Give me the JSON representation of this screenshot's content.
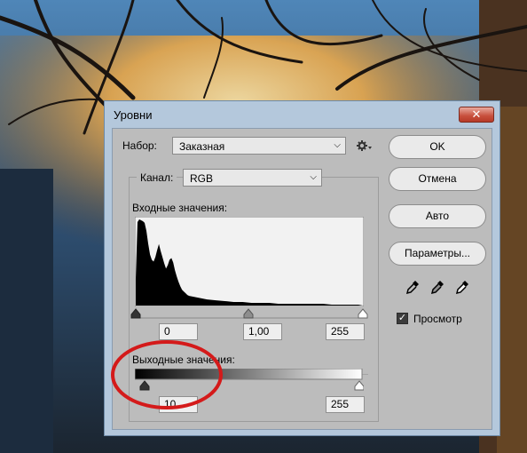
{
  "window": {
    "title": "Уровни",
    "close_glyph": "✕"
  },
  "preset": {
    "label": "Набор:",
    "value": "Заказная",
    "options_icon": "gear-icon"
  },
  "channel": {
    "label": "Канал:",
    "value": "RGB"
  },
  "input": {
    "label": "Входные значения:",
    "black": "0",
    "gamma": "1,00",
    "white": "255"
  },
  "output": {
    "label": "Выходные значения:",
    "black": "10",
    "white": "255"
  },
  "buttons": {
    "ok": "OK",
    "cancel": "Отмена",
    "auto": "Авто",
    "options": "Параметры..."
  },
  "eyedroppers": [
    "black-eyedropper-icon",
    "gray-eyedropper-icon",
    "white-eyedropper-icon"
  ],
  "preview": {
    "label": "Просмотр",
    "checked": true
  },
  "chart_data": {
    "type": "area",
    "xlim": [
      0,
      255
    ],
    "ylim": [
      0,
      100
    ],
    "x": [
      0,
      2,
      4,
      6,
      8,
      10,
      12,
      14,
      16,
      18,
      20,
      22,
      24,
      26,
      28,
      30,
      32,
      34,
      36,
      38,
      40,
      42,
      44,
      46,
      48,
      50,
      52,
      54,
      56,
      58,
      60,
      65,
      70,
      75,
      80,
      90,
      100,
      110,
      120,
      130,
      140,
      150,
      160,
      170,
      180,
      190,
      200,
      210,
      220,
      230,
      240,
      250,
      255
    ],
    "values": [
      30,
      95,
      98,
      97,
      96,
      94,
      85,
      70,
      58,
      52,
      50,
      55,
      63,
      70,
      62,
      55,
      48,
      42,
      46,
      52,
      54,
      49,
      40,
      33,
      27,
      22,
      18,
      16,
      14,
      12,
      11,
      10,
      9,
      8,
      7,
      6,
      5,
      4,
      4,
      3,
      3,
      3,
      2,
      2,
      2,
      2,
      2,
      2,
      1,
      1,
      1,
      1,
      0
    ]
  },
  "colors": {
    "accent_annotation": "#d41a1a",
    "window_frame": "#b4c8dc",
    "dialog_bg": "#bcbcbc"
  }
}
